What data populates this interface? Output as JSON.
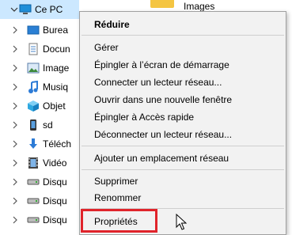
{
  "nav": {
    "items": [
      {
        "label": "Ce PC",
        "icon": "computer-icon",
        "expanded": true,
        "selected": true
      },
      {
        "label": "Burea",
        "icon": "desktop-icon"
      },
      {
        "label": "Docun",
        "icon": "documents-icon"
      },
      {
        "label": "Image",
        "icon": "pictures-icon"
      },
      {
        "label": "Musiq",
        "icon": "music-icon"
      },
      {
        "label": "Objet",
        "icon": "3d-objects-icon"
      },
      {
        "label": "sd",
        "icon": "phone-icon"
      },
      {
        "label": "Téléch",
        "icon": "downloads-icon"
      },
      {
        "label": "Vidéo",
        "icon": "videos-icon"
      },
      {
        "label": "Disqu",
        "icon": "drive-icon"
      },
      {
        "label": "Disqu",
        "icon": "drive-icon"
      },
      {
        "label": "Disqu",
        "icon": "drive-icon"
      }
    ]
  },
  "content": {
    "folder_label": "Images"
  },
  "context_menu": {
    "header": "Réduire",
    "group1": [
      "Gérer",
      "Épingler à l’écran de démarrage",
      "Connecter un lecteur réseau...",
      "Ouvrir dans une nouvelle fenêtre",
      "Épingler à Accès rapide",
      "Déconnecter un lecteur réseau..."
    ],
    "group2": [
      "Ajouter un emplacement réseau"
    ],
    "group3": [
      "Supprimer",
      "Renommer"
    ],
    "group4": [
      "Propriétés"
    ]
  },
  "colors": {
    "selection": "#cce8ff",
    "menu_bg": "#f2f2f2",
    "highlight_box": "#e0242b"
  }
}
